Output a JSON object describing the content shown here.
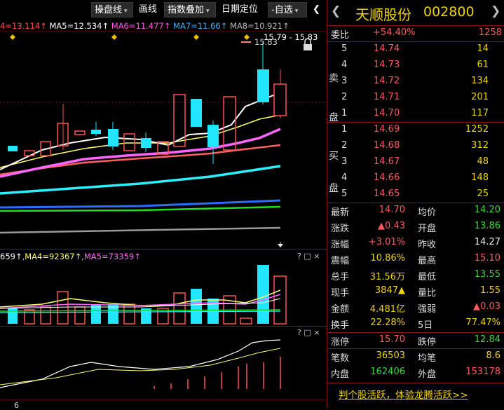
{
  "toolbar": {
    "buttons": [
      {
        "label": "操盘线",
        "dropdown": true
      },
      {
        "label": "画线",
        "dropdown": false
      },
      {
        "label": "指数叠加",
        "dropdown": true
      },
      {
        "label": "日期定位",
        "dropdown": false
      },
      {
        "label": "-自选",
        "dropdown": true
      }
    ],
    "collapse_glyph": "❮"
  },
  "ma_legend": {
    "ma4": "4=13.114↑",
    "ma5": "MA5=12.534↑",
    "ma6": "MA6=11.477↑",
    "ma7": "MA7=11.66↑",
    "ma8": "MA8=10.921↑",
    "colors": {
      "ma4": "#ff4d4d",
      "ma5": "#ffffff",
      "ma6": "#e65ce6",
      "ma7": "#36b5ff",
      "ma8": "#aaaaaa"
    }
  },
  "price_chart": {
    "high_label": "15.79 - 15.83",
    "high_marker": "15.83"
  },
  "volume_legend": {
    "v1": "659↑",
    "ma4": "MA4=92367↑",
    "ma5": "MA5=73359↑"
  },
  "pane_icons": {
    "help": "?",
    "restore": "□",
    "close": "×"
  },
  "bottom_axis": {
    "label": "6"
  },
  "stock": {
    "name": "天顺股份",
    "code": "002800",
    "prev_arrow": "❮",
    "next_arrow": "❯"
  },
  "weibi": {
    "label": "委比",
    "value": "+54.40%",
    "volume": "1258"
  },
  "sell_side_label": [
    "卖",
    "盘"
  ],
  "buy_side_label": [
    "买",
    "盘"
  ],
  "asks": [
    {
      "level": "5",
      "price": "14.74",
      "volume": "14"
    },
    {
      "level": "4",
      "price": "14.73",
      "volume": "61"
    },
    {
      "level": "3",
      "price": "14.72",
      "volume": "134"
    },
    {
      "level": "2",
      "price": "14.71",
      "volume": "201"
    },
    {
      "level": "1",
      "price": "14.70",
      "volume": "117"
    }
  ],
  "bids": [
    {
      "level": "1",
      "price": "14.69",
      "volume": "1252"
    },
    {
      "level": "2",
      "price": "14.68",
      "volume": "312"
    },
    {
      "level": "3",
      "price": "14.67",
      "volume": "48"
    },
    {
      "level": "4",
      "price": "14.66",
      "volume": "148"
    },
    {
      "level": "5",
      "price": "14.65",
      "volume": "25"
    }
  ],
  "stats": [
    {
      "l1": "最新",
      "v1": "14.70",
      "c1": "red",
      "l2": "均价",
      "v2": "14.20",
      "c2": "green"
    },
    {
      "l1": "涨跌",
      "v1": "▲0.43",
      "c1": "red",
      "l2": "开盘",
      "v2": "13.86",
      "c2": "green"
    },
    {
      "l1": "涨幅",
      "v1": "+3.01%",
      "c1": "red",
      "l2": "昨收",
      "v2": "14.27",
      "c2": "white"
    },
    {
      "l1": "震幅",
      "v1": "10.86%",
      "c1": "yellow",
      "l2": "最高",
      "v2": "15.10",
      "c2": "red"
    },
    {
      "l1": "总手",
      "v1": "31.56万",
      "c1": "yellow",
      "l2": "最低",
      "v2": "13.55",
      "c2": "green"
    },
    {
      "l1": "现手",
      "v1": "3847▲",
      "c1": "yellow",
      "l2": "量比",
      "v2": "1.55",
      "c2": "yellow"
    },
    {
      "l1": "金额",
      "v1": "4.481亿",
      "c1": "yellow",
      "l2": "强弱",
      "v2": "▲0.03",
      "c2": "red"
    },
    {
      "l1": "换手",
      "v1": "22.28%",
      "c1": "yellow",
      "l2": "5日",
      "v2": "77.47%",
      "c2": "yellow"
    }
  ],
  "limits": {
    "up_label": "涨停",
    "up": "15.70",
    "down_label": "跌停",
    "down": "12.84"
  },
  "trades": [
    {
      "l1": "笔数",
      "v1": "36503",
      "c1": "yellow",
      "l2": "均笔",
      "v2": "8.6",
      "c2": "yellow"
    },
    {
      "l1": "内盘",
      "v1": "162406",
      "c1": "green",
      "l2": "外盘",
      "v2": "153178",
      "c2": "red"
    }
  ],
  "promo": {
    "text": "判个股活跃，体验龙腾活跃>>"
  }
}
